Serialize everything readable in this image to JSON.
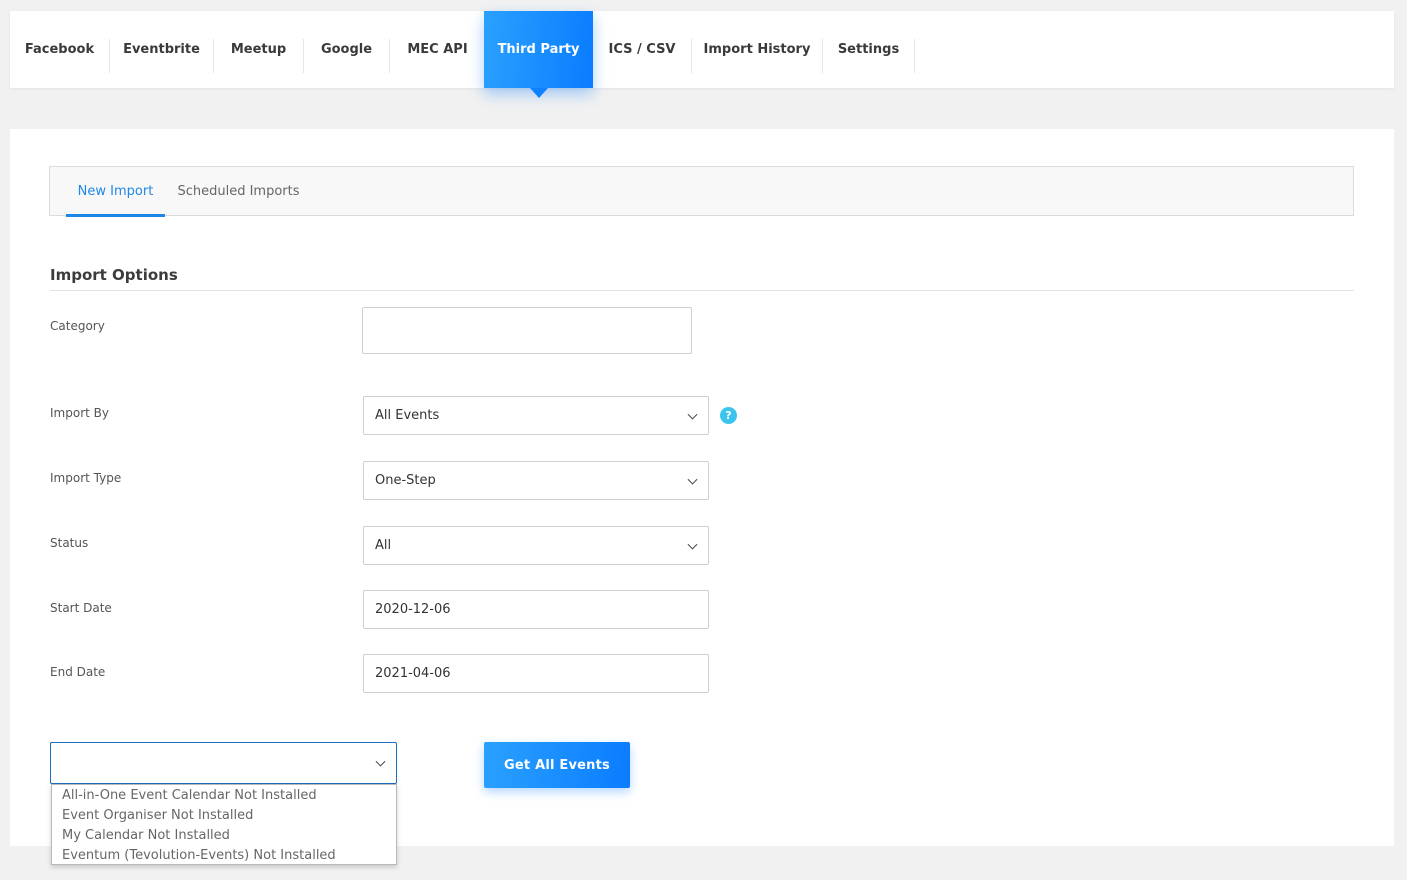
{
  "top_tabs": [
    {
      "label": "Facebook"
    },
    {
      "label": "Eventbrite"
    },
    {
      "label": "Meetup"
    },
    {
      "label": "Google"
    },
    {
      "label": "MEC API"
    },
    {
      "label": "Third Party",
      "active": true
    },
    {
      "label": "ICS / CSV"
    },
    {
      "label": "Import History"
    },
    {
      "label": "Settings"
    }
  ],
  "sub_tabs": [
    {
      "label": "New Import",
      "active": true
    },
    {
      "label": "Scheduled Imports"
    }
  ],
  "section_title": "Import Options",
  "form": {
    "category": {
      "label": "Category",
      "value": ""
    },
    "import_by": {
      "label": "Import By",
      "value": "All Events",
      "help_icon": "question-circle-icon"
    },
    "import_type": {
      "label": "Import Type",
      "value": "One-Step"
    },
    "status": {
      "label": "Status",
      "value": "All"
    },
    "start_date": {
      "label": "Start Date",
      "value": "2020-12-06"
    },
    "end_date": {
      "label": "End Date",
      "value": "2021-04-06"
    }
  },
  "plugin_select": {
    "value": "",
    "options": [
      "All-in-One Event Calendar Not Installed",
      "Event Organiser Not Installed",
      "My Calendar Not Installed",
      "Eventum (Tevolution-Events) Not Installed"
    ]
  },
  "get_events_button": "Get All Events",
  "colors": {
    "accent": "#0a7cff",
    "accent_light": "#2aa1ff",
    "help": "#3bc5ee"
  }
}
